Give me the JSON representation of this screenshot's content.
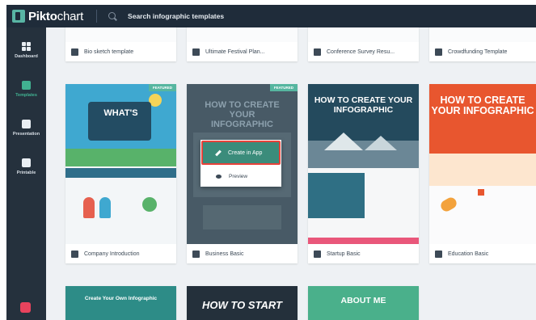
{
  "app": {
    "logo_prefix": "Pikto",
    "logo_suffix": "chart",
    "search_placeholder": "Search infographic templates"
  },
  "sidebar": {
    "items": [
      {
        "label": "Dashboard"
      },
      {
        "label": "Templates"
      },
      {
        "label": "Presentation"
      },
      {
        "label": "Printable"
      }
    ]
  },
  "top_row": [
    {
      "label": "Bio sketch template"
    },
    {
      "label": "Ultimate Festival Plan..."
    },
    {
      "label": "Conference Survey Resu..."
    },
    {
      "label": "Crowdfunding Template"
    }
  ],
  "cards": [
    {
      "label": "Company Introduction",
      "badge": "FEATURED",
      "headline": "WHAT'S"
    },
    {
      "label": "Business Basic",
      "badge": "FEATURED",
      "headline": "HOW TO CREATE YOUR INFOGRAPHIC"
    },
    {
      "label": "Startup Basic",
      "headline": "HOW TO CREATE YOUR INFOGRAPHIC"
    },
    {
      "label": "Education Basic",
      "headline": "HOW TO CREATE YOUR INFOGRAPHIC"
    }
  ],
  "popup": {
    "create_label": "Create in App",
    "preview_label": "Preview"
  },
  "bottom_row": [
    {
      "headline": "Create Your Own Infographic"
    },
    {
      "headline": "HOW TO START"
    },
    {
      "headline": "ABOUT ME"
    }
  ],
  "colors": {
    "sidebar": "#25313d",
    "topbar": "#1f2c3a",
    "accent": "#56b6a0",
    "highlight": "#e8423a"
  }
}
